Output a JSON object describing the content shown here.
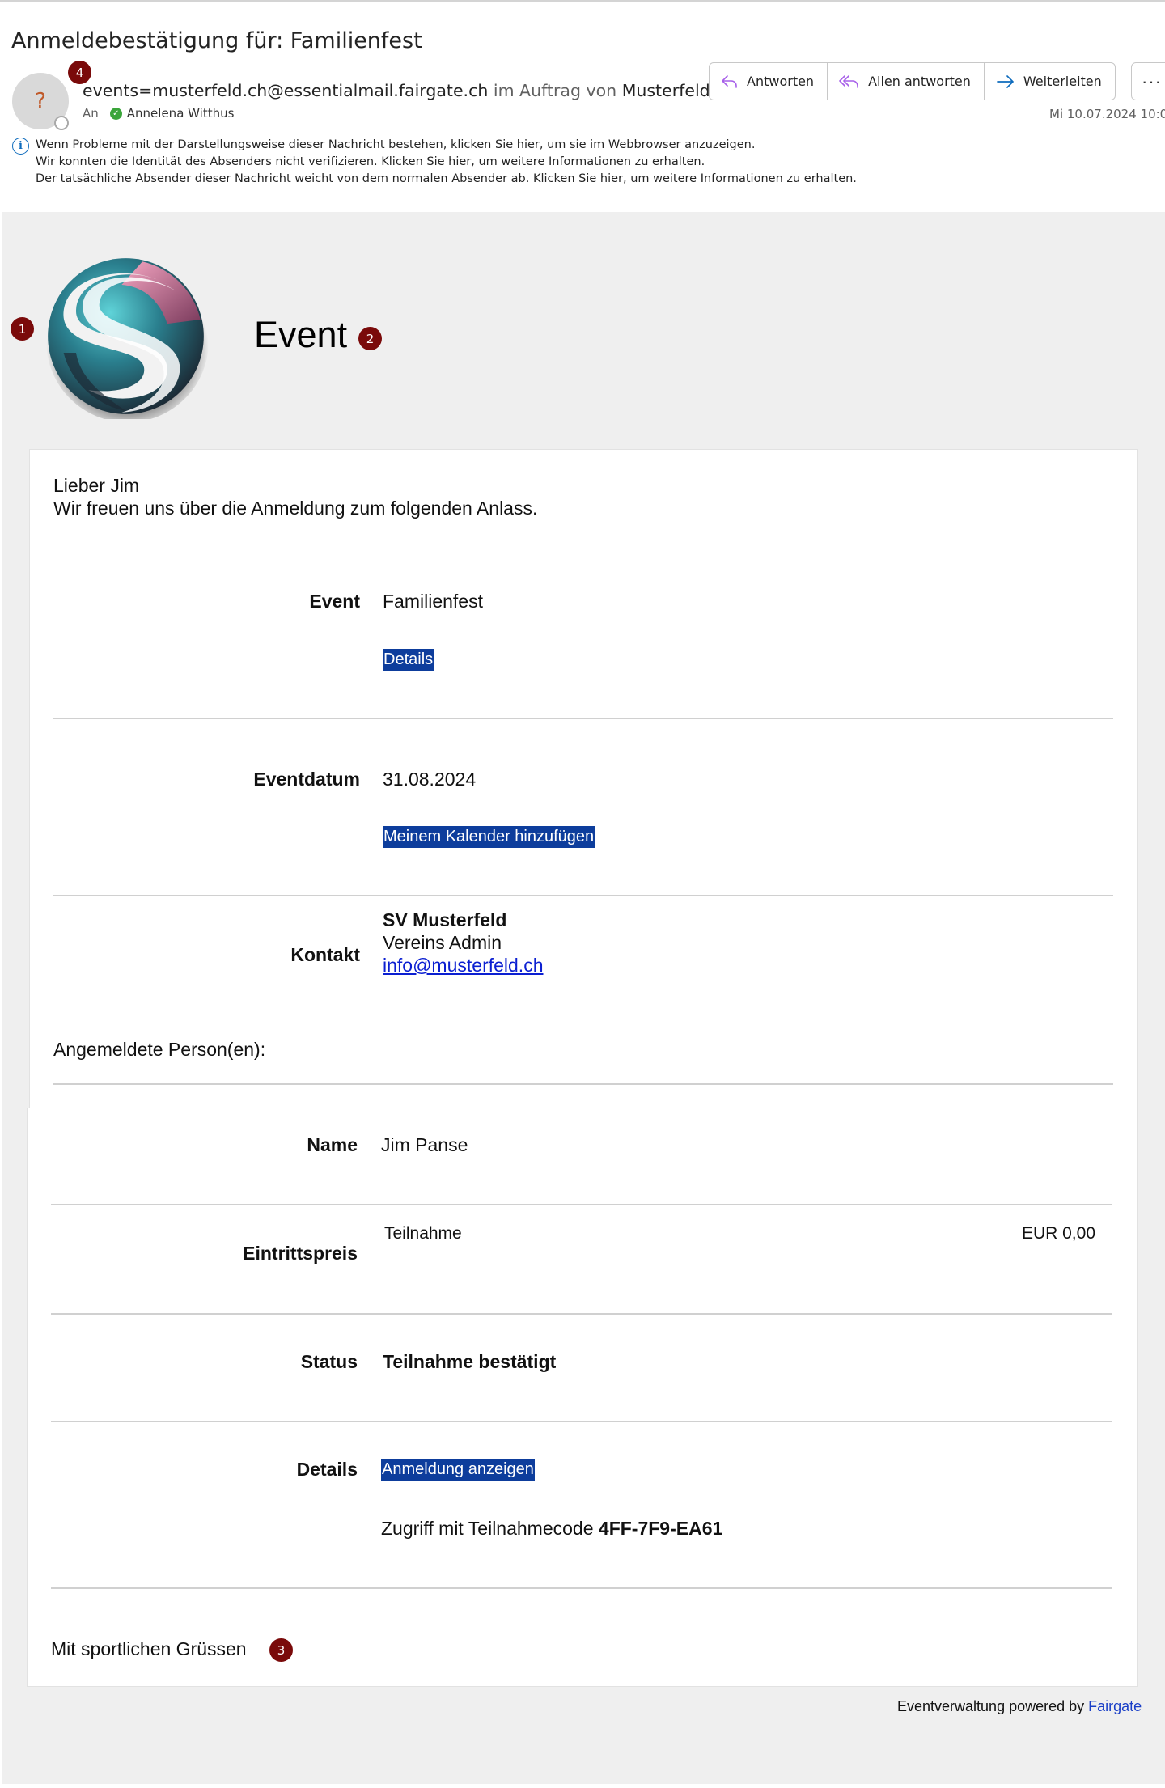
{
  "mail": {
    "subject": "Anmeldebestätigung für: Familienfest",
    "avatar_initial": "?",
    "sender_address": "events=musterfeld.ch@essentialmail.fairgate.ch",
    "sender_on_behalf": "im Auftrag von",
    "sender_name": "Musterfeld",
    "to_label": "An",
    "recipient": "Annelena Witthus",
    "timestamp": "Mi 10.07.2024 10:0",
    "actions": {
      "reply": "Antworten",
      "reply_all": "Allen antworten",
      "forward": "Weiterleiten",
      "more": "···"
    },
    "notices": [
      "Wenn Probleme mit der Darstellungsweise dieser Nachricht bestehen, klicken Sie hier, um sie im Webbrowser anzuzeigen.",
      "Wir konnten die Identität des Absenders nicht verifizieren. Klicken Sie hier, um weitere Informationen zu erhalten.",
      "Der tatsächliche Absender dieser Nachricht weicht von dem normalen Absender ab. Klicken Sie hier, um weitere Informationen zu erhalten."
    ]
  },
  "markers": [
    "1",
    "2",
    "3",
    "4"
  ],
  "body": {
    "title": "Event",
    "greeting": "Lieber Jim",
    "intro": "Wir freuen uns über die Anmeldung zum folgenden Anlass.",
    "event": {
      "label": "Event",
      "value": "Familienfest",
      "details_button": "Details"
    },
    "date": {
      "label": "Eventdatum",
      "value": "31.08.2024",
      "calendar_button": "Meinem Kalender hinzufügen"
    },
    "contact": {
      "label": "Kontakt",
      "org": "SV Musterfeld",
      "role": "Vereins Admin",
      "email": "info@musterfeld.ch"
    },
    "registered_heading": "Angemeldete Person(en):",
    "person": {
      "name_label": "Name",
      "name_value": "Jim Panse",
      "fee_label": "Eintrittspreis",
      "fee_item": "Teilnahme",
      "fee_amount": "EUR 0,00",
      "status_label": "Status",
      "status_value": "Teilnahme bestätigt",
      "details_label": "Details",
      "details_button": "Anmeldung anzeigen",
      "access_text": "Zugriff mit Teilnahmecode",
      "access_code": "4FF-7F9-EA61"
    },
    "closing": "Mit sportlichen Grüssen"
  },
  "footer": {
    "text": "Eventverwaltung powered by",
    "brand": "Fairgate"
  },
  "colors": {
    "button_bg": "#0d3d9c",
    "marker_bg": "#7a0a0a",
    "link": "#0b1fd1",
    "body_bg": "#efefef"
  }
}
